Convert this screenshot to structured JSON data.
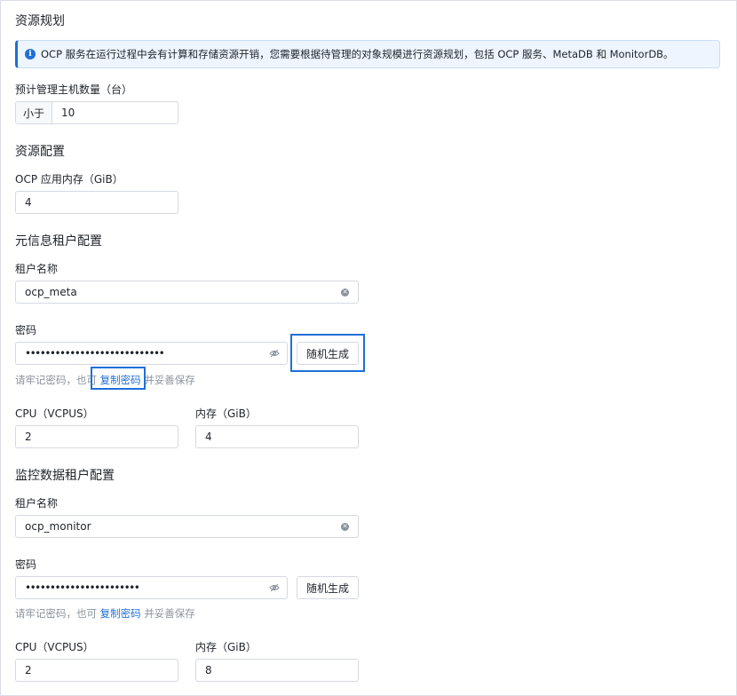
{
  "planning": {
    "title": "资源规划",
    "alert_text": "OCP 服务在运行过程中会有计算和存储资源开销，您需要根据待管理的对象规模进行资源规划，包括 OCP 服务、MetaDB 和 MonitorDB。",
    "host_count_label": "预计管理主机数量（台）",
    "host_count_prefix": "小于",
    "host_count_value": "10"
  },
  "resource_config": {
    "title": "资源配置",
    "memory_label": "OCP 应用内存（GiB）",
    "memory_value": "4"
  },
  "meta_tenant": {
    "title": "元信息租户配置",
    "name_label": "租户名称",
    "name_value": "ocp_meta",
    "password_label": "密码",
    "password_mask": "••••••••••••••••••••••••••••",
    "random_button": "随机生成",
    "hint_prefix": "请牢记密码，也可",
    "hint_link": "复制密码",
    "hint_suffix": "并妥善保存",
    "cpu_label": "CPU（VCPUS）",
    "cpu_value": "2",
    "mem_label": "内存（GiB）",
    "mem_value": "4"
  },
  "monitor_tenant": {
    "title": "监控数据租户配置",
    "name_label": "租户名称",
    "name_value": "ocp_monitor",
    "password_label": "密码",
    "password_mask": "•••••••••••••••••••••••",
    "random_button": "随机生成",
    "hint_prefix": "请牢记密码，也可",
    "hint_link": "复制密码",
    "hint_suffix": "并妥善保存",
    "cpu_label": "CPU（VCPUS）",
    "cpu_value": "2",
    "mem_label": "内存（GiB）",
    "mem_value": "8"
  },
  "icons": {
    "info": "info-icon",
    "clear": "clear-icon",
    "eye_off": "eye-off-icon"
  },
  "colors": {
    "accent": "#1f6fd6",
    "alert_bg": "#eef5ff",
    "muted_text": "#8b929c"
  }
}
